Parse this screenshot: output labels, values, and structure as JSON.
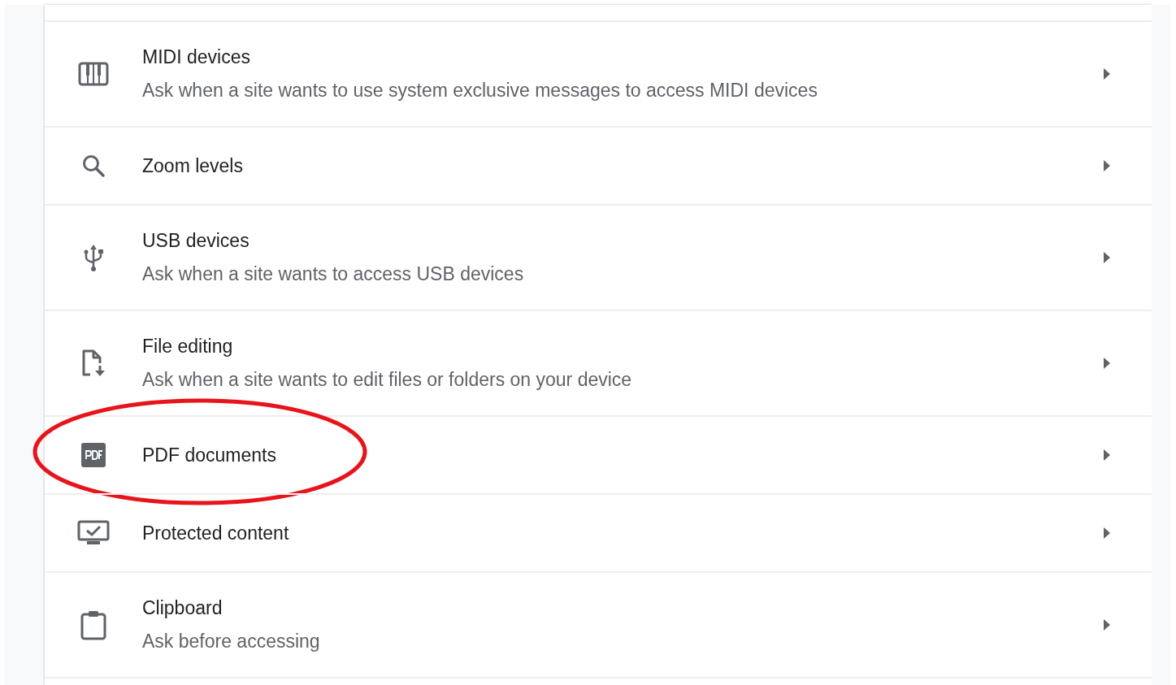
{
  "rows": [
    {
      "title": "MIDI devices",
      "subtitle": "Ask when a site wants to use system exclusive messages to access MIDI devices",
      "circled": false
    },
    {
      "title": "Zoom levels",
      "circled": false
    },
    {
      "title": "USB devices",
      "subtitle": "Ask when a site wants to access USB devices",
      "circled": false
    },
    {
      "title": "File editing",
      "subtitle": "Ask when a site wants to edit files or folders on your device",
      "circled": false
    },
    {
      "title": "PDF documents",
      "circled": true
    },
    {
      "title": "Protected content",
      "circled": false
    },
    {
      "title": "Clipboard",
      "subtitle": "Ask before accessing",
      "circled": false
    }
  ]
}
